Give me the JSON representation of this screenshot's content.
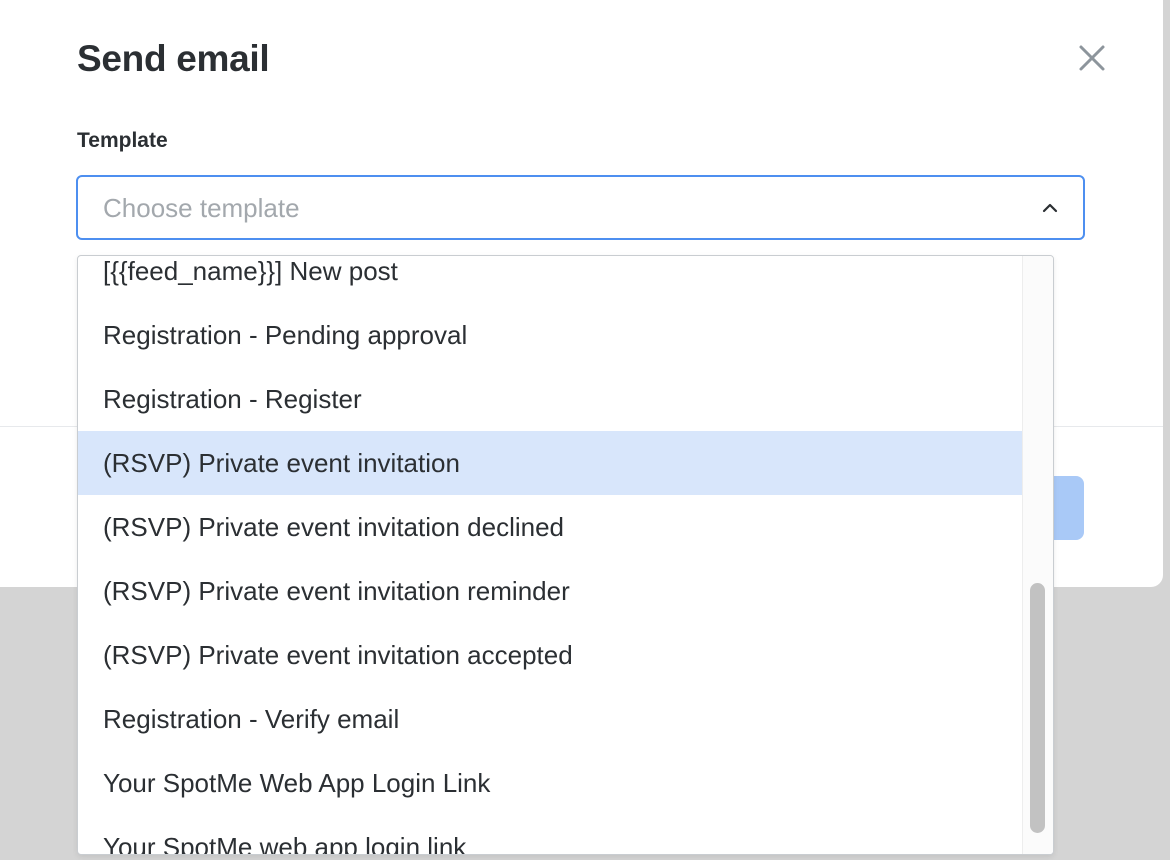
{
  "modal": {
    "title": "Send email",
    "close_icon": "close-icon"
  },
  "template_field": {
    "label": "Template",
    "placeholder": "Choose template",
    "chevron_icon": "chevron-up-icon"
  },
  "dropdown": {
    "options": [
      {
        "label": "[{{feed_name}}] New post"
      },
      {
        "label": "Registration - Pending approval"
      },
      {
        "label": "Registration - Register"
      },
      {
        "label": "(RSVP) Private event invitation"
      },
      {
        "label": "(RSVP) Private event invitation declined"
      },
      {
        "label": "(RSVP) Private event invitation reminder"
      },
      {
        "label": "(RSVP) Private event invitation accepted"
      },
      {
        "label": "Registration - Verify email"
      },
      {
        "label": "Your SpotMe Web App Login Link"
      },
      {
        "label": "Your SpotMe web app login link"
      }
    ],
    "highlighted_index": 3
  },
  "colors": {
    "accent": "#4d8ff0",
    "highlight": "#d8e6fb",
    "primary_disabled": "#a9c9f7"
  }
}
